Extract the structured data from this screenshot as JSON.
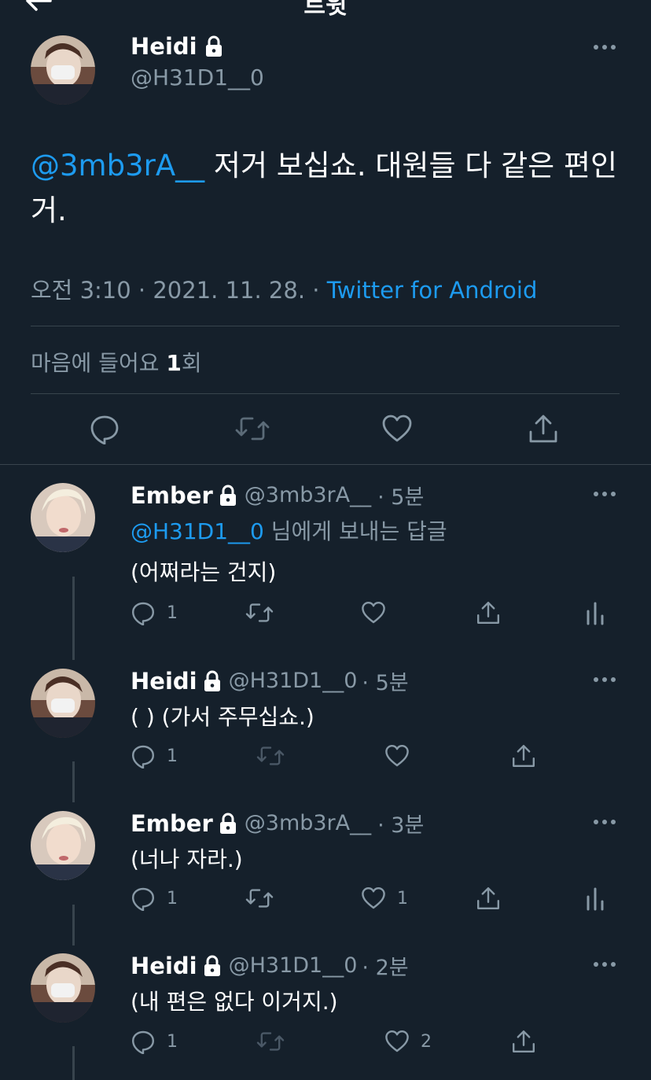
{
  "header": {
    "title": "트윗"
  },
  "main_tweet": {
    "name": "Heidi",
    "handle": "@H31D1__0",
    "mention": "@3mb3rA__",
    "text": " 저거 보십쇼. 대원들 다 같은 편인 거.",
    "time": "오전 3:10 · 2021. 11. 28. · ",
    "source": "Twitter for Android",
    "likes_prefix": "마음에 들어요 ",
    "likes_count": "1",
    "likes_suffix": "회"
  },
  "replies": [
    {
      "name": "Ember",
      "handle": "@3mb3rA__",
      "time": "· 5분",
      "reply_to_mention": "@H31D1__0",
      "reply_to_text": " 님에게 보내는 답글",
      "text": "(어쩌라는 건지)",
      "reply_count": "1",
      "like_count": ""
    },
    {
      "name": "Heidi",
      "handle": "@H31D1__0",
      "time": "· 5분",
      "text": "( ) (가서 주무십쇼.)",
      "reply_count": "1",
      "like_count": ""
    },
    {
      "name": "Ember",
      "handle": "@3mb3rA__",
      "time": "· 3분",
      "text": "(너나 자라.)",
      "reply_count": "1",
      "like_count": "1"
    },
    {
      "name": "Heidi",
      "handle": "@H31D1__0",
      "time": "· 2분",
      "text": "(내 편은 없다 이거지.)",
      "reply_count": "1",
      "like_count": "2"
    }
  ],
  "colors": {
    "background": "#15202b",
    "link": "#1d9bf0",
    "muted": "#8899a6",
    "divider": "#38444d"
  }
}
